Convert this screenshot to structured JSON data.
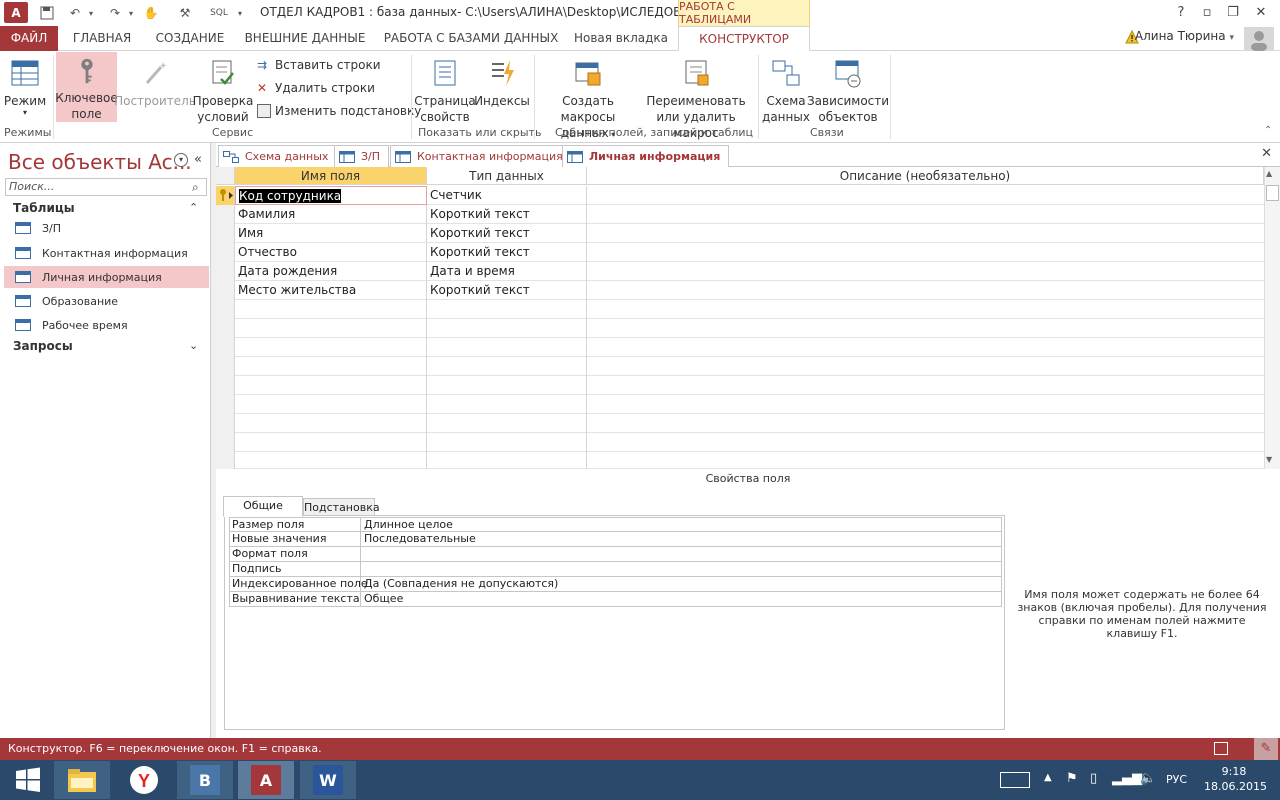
{
  "window": {
    "title": "ОТДЕЛ КАДРОВ1 : база данных- C:\\Users\\АЛИНА\\Desktop\\ИСЛЕДОВАТЕЛ...",
    "context_tab": "РАБОТА С ТАБЛИЦАМИ",
    "qat_sql": "SQL",
    "app_logo": "A"
  },
  "ribbon_tabs": [
    "ФАЙЛ",
    "ГЛАВНАЯ",
    "СОЗДАНИЕ",
    "ВНЕШНИЕ ДАННЫЕ",
    "РАБОТА С БАЗАМИ ДАННЫХ",
    "Новая вкладка",
    "КОНСТРУКТОР"
  ],
  "user": "Алина Тюрина",
  "ribbon": {
    "mode": "Режим",
    "key_field_1": "Ключевое",
    "key_field_2": "поле",
    "builder": "Построитель",
    "check_1": "Проверка",
    "check_2": "условий",
    "insert_rows": "Вставить строки",
    "delete_rows": "Удалить строки",
    "modify_lookup": "Изменить подстановку",
    "prop_sheet_1": "Страница",
    "prop_sheet_2": "свойств",
    "indexes": "Индексы",
    "create_macro_1": "Создать макросы",
    "create_macro_2": "данных",
    "rename_macro_1": "Переименовать",
    "rename_macro_2": "или удалить макрос",
    "schema_1": "Схема",
    "schema_2": "данных",
    "deps_1": "Зависимости",
    "deps_2": "объектов",
    "group_modes": "Режимы",
    "group_service": "Сервис",
    "group_show": "Показать или скрыть",
    "group_events": "События полей, записей и таблиц",
    "group_links": "Связи"
  },
  "nav": {
    "header": "Все объекты Ac...",
    "search_placeholder": "Поиск...",
    "group_tables": "Таблицы",
    "group_queries": "Запросы",
    "tables": [
      "З/П",
      "Контактная информация",
      "Личная информация",
      "Образование",
      "Рабочее время"
    ]
  },
  "doc_tabs": [
    "Схема данных",
    "З/П",
    "Контактная информация",
    "Личная информация"
  ],
  "grid": {
    "headers": [
      "Имя поля",
      "Тип данных",
      "Описание (необязательно)"
    ],
    "rows": [
      {
        "name": "Код сотрудника",
        "type": "Счетчик"
      },
      {
        "name": "Фамилия",
        "type": "Короткий текст"
      },
      {
        "name": "Имя",
        "type": "Короткий текст"
      },
      {
        "name": "Отчество",
        "type": "Короткий текст"
      },
      {
        "name": "Дата рождения",
        "type": "Дата и время"
      },
      {
        "name": "Место жительства",
        "type": "Короткий текст"
      }
    ]
  },
  "props": {
    "title": "Свойства поля",
    "tab_general": "Общие",
    "tab_lookup": "Подстановка",
    "rows": [
      {
        "key": "Размер поля",
        "value": "Длинное целое"
      },
      {
        "key": "Новые значения",
        "value": "Последовательные"
      },
      {
        "key": "Формат поля",
        "value": ""
      },
      {
        "key": "Подпись",
        "value": ""
      },
      {
        "key": "Индексированное поле",
        "value": "Да (Совпадения не допускаются)"
      },
      {
        "key": "Выравнивание текста",
        "value": "Общее"
      }
    ],
    "help": "Имя поля может содержать не более 64 знаков (включая пробелы). Для получения справки по именам полей нажмите клавишу F1."
  },
  "status": "Конструктор.  F6 = переключение окон.  F1 = справка.",
  "taskbar": {
    "lang": "РУС",
    "time": "9:18",
    "date": "18.06.2015",
    "word_letter": "W",
    "vk_letter": "B"
  },
  "colors": {
    "accent": "#a4373a",
    "header_highlight": "#fbd36d",
    "nav_selected": "#f4c7c9",
    "taskbar": "#2b4a6b"
  }
}
